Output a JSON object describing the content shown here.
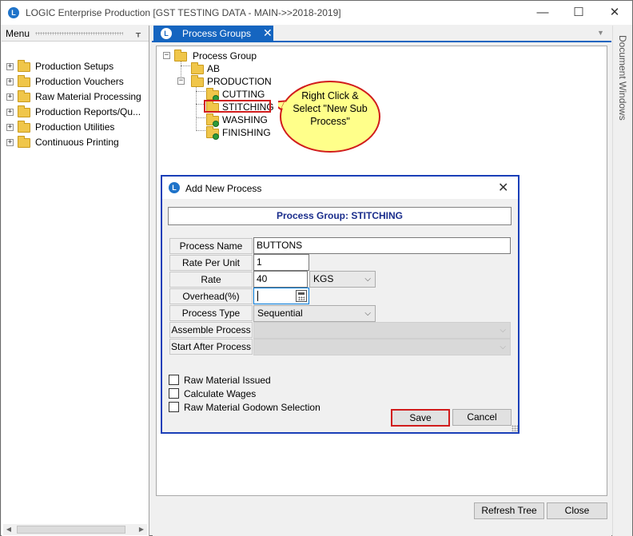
{
  "app": {
    "logo": "L",
    "title": "LOGIC Enterprise Production  [GST TESTING DATA - MAIN->>2018-2019]",
    "minimize": "—",
    "maximize": "☐",
    "close": "✕"
  },
  "menu": {
    "header": "Menu",
    "pin": "ᚁ",
    "items": [
      {
        "expander": "+",
        "label": "Production Setups"
      },
      {
        "expander": "+",
        "label": "Production Vouchers"
      },
      {
        "expander": "+",
        "label": "Raw Material Processing"
      },
      {
        "expander": "+",
        "label": "Production  Reports/Qu..."
      },
      {
        "expander": "+",
        "label": "Production Utilities"
      },
      {
        "expander": "+",
        "label": "Continuous Printing"
      }
    ]
  },
  "tabs": [
    {
      "logo": "L",
      "label": "Process Groups",
      "close": "✕"
    }
  ],
  "tab_dropdown": "▼",
  "right_sidebar": {
    "label": "Document Windows"
  },
  "tree": {
    "root": {
      "label": "Process Group",
      "expander": "−"
    },
    "nodes": {
      "ab": "AB",
      "production": "PRODUCTION",
      "production_expander": "−",
      "cutting": "CUTTING",
      "stitching": "STITCHING",
      "washing": "WASHING",
      "finishing": "FINISHING"
    }
  },
  "callout": {
    "text": "Right Click & Select \"New Sub Process\""
  },
  "dialog": {
    "logo": "L",
    "title": "Add New Process",
    "close": "✕",
    "group_header": "Process Group: STITCHING",
    "fields": {
      "process_name": {
        "label": "Process Name",
        "value": "BUTTONS"
      },
      "rate_per_unit": {
        "label": "Rate Per Unit",
        "value": "1"
      },
      "rate": {
        "label": "Rate",
        "value": "40",
        "unit": "KGS"
      },
      "overhead": {
        "label": "Overhead(%)",
        "value": ""
      },
      "process_type": {
        "label": "Process Type",
        "value": "Sequential"
      },
      "assemble_process": {
        "label": "Assemble Process",
        "value": ""
      },
      "start_after_process": {
        "label": "Start After Process",
        "value": ""
      }
    },
    "chevron": "⌵",
    "checkboxes": [
      {
        "label": "Raw Material Issued",
        "checked": false
      },
      {
        "label": "Calculate Wages",
        "checked": false
      },
      {
        "label": "Raw Material Godown Selection",
        "checked": false
      }
    ],
    "buttons": {
      "save": "Save",
      "cancel": "Cancel"
    }
  },
  "footer_buttons": {
    "refresh": "Refresh Tree",
    "close": "Close"
  },
  "scroll": {
    "left": "◀",
    "right": "▶"
  }
}
